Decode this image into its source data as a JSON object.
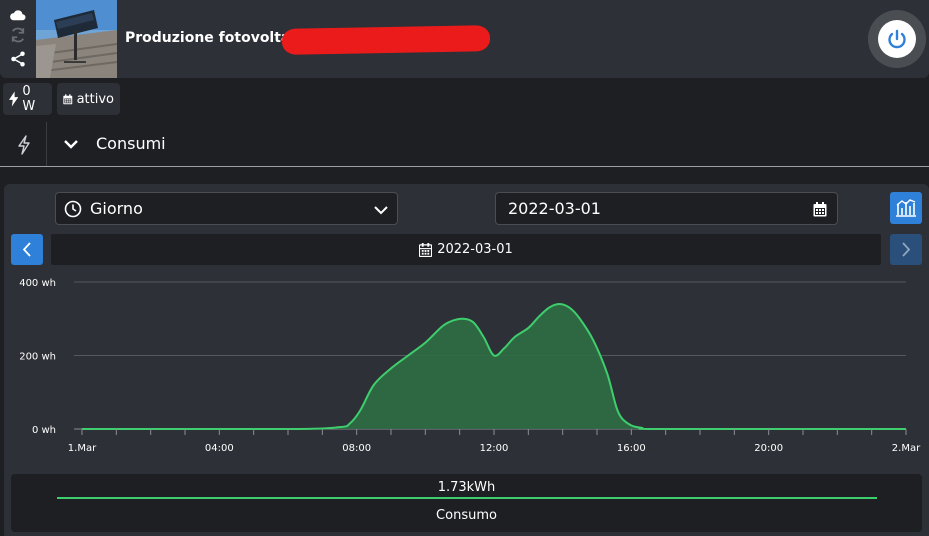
{
  "device": {
    "name": "Produzione fotovoltaico"
  },
  "badges": {
    "power": "0 W",
    "status": "attivo"
  },
  "section": {
    "title": "Consumi"
  },
  "controls": {
    "period": "Giorno",
    "date_input": "2022-03-01",
    "date_display": "2022-03-01"
  },
  "icons": {
    "cloud": "cloud-icon",
    "refresh": "refresh-icon",
    "share": "share-icon",
    "power": "power-icon",
    "bolt": "bolt-icon",
    "calendar": "calendar-icon",
    "clock": "clock-icon",
    "chevron": "chevron-down-icon",
    "chart": "chart-icon"
  },
  "colors": {
    "accent": "#2f80d8",
    "series": "#3fce6d",
    "fill": "#2e6b45"
  },
  "chart_data": {
    "type": "area",
    "title": "",
    "xlabel": "",
    "ylabel": "",
    "x_ticks": [
      "1.Mar",
      "04:00",
      "08:00",
      "12:00",
      "16:00",
      "20:00",
      "2.Mar"
    ],
    "y_ticks": [
      "0 wh",
      "200 wh",
      "400 wh"
    ],
    "ylim": [
      0,
      400
    ],
    "xlim_hours": [
      0,
      24
    ],
    "grid": true,
    "series": [
      {
        "name": "Consumo",
        "x": [
          0,
          6,
          7.5,
          7.8,
          8.1,
          8.5,
          9,
          9.5,
          10,
          10.5,
          10.8,
          11.1,
          11.4,
          11.7,
          12,
          12.3,
          12.6,
          13,
          13.3,
          13.6,
          13.9,
          14.2,
          14.5,
          14.9,
          15.3,
          15.6,
          15.9,
          16.3,
          17,
          24
        ],
        "y": [
          0,
          0,
          5,
          15,
          50,
          120,
          165,
          200,
          235,
          280,
          295,
          300,
          290,
          250,
          200,
          220,
          250,
          275,
          305,
          330,
          340,
          330,
          300,
          240,
          150,
          50,
          15,
          3,
          0,
          0
        ]
      }
    ],
    "total": "1.73kWh",
    "legend": "Consumo"
  }
}
